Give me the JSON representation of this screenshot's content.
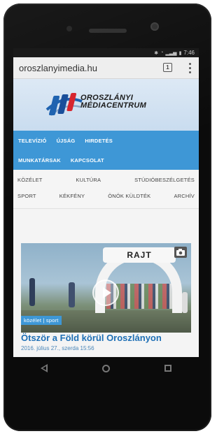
{
  "statusbar": {
    "time": "7:46"
  },
  "browser": {
    "url": "oroszlanyimedia.hu",
    "tab_count": "1"
  },
  "site": {
    "brand_line1": "OROSZLÁNYI",
    "brand_line2": "MÉDIACENTRUM"
  },
  "main_nav": {
    "row1": [
      "TELEVÍZIÓ",
      "ÚJSÁG",
      "HIRDETÉS"
    ],
    "row2": [
      "MUNKATÁRSAK",
      "KAPCSOLAT"
    ]
  },
  "category_nav": {
    "row1": [
      "KÖZÉLET",
      "KULTÚRA",
      "STÚDIÓBESZÉLGETÉS"
    ],
    "row2": [
      "SPORT",
      "KÉKFÉNY",
      "ÖNÖK KÜLDTÉK",
      "ARCHÍV"
    ]
  },
  "article": {
    "photo_sign": "RAJT",
    "tag": "közélet | sport",
    "headline": "Ötször a Föld körül Oroszlányon",
    "date": "2016. július 27., szerda 15:56"
  },
  "colors": {
    "nav_blue": "#3e97d6",
    "headline_blue": "#1e6fb5",
    "logo_red": "#d7262f",
    "logo_blue": "#1f63b0"
  }
}
